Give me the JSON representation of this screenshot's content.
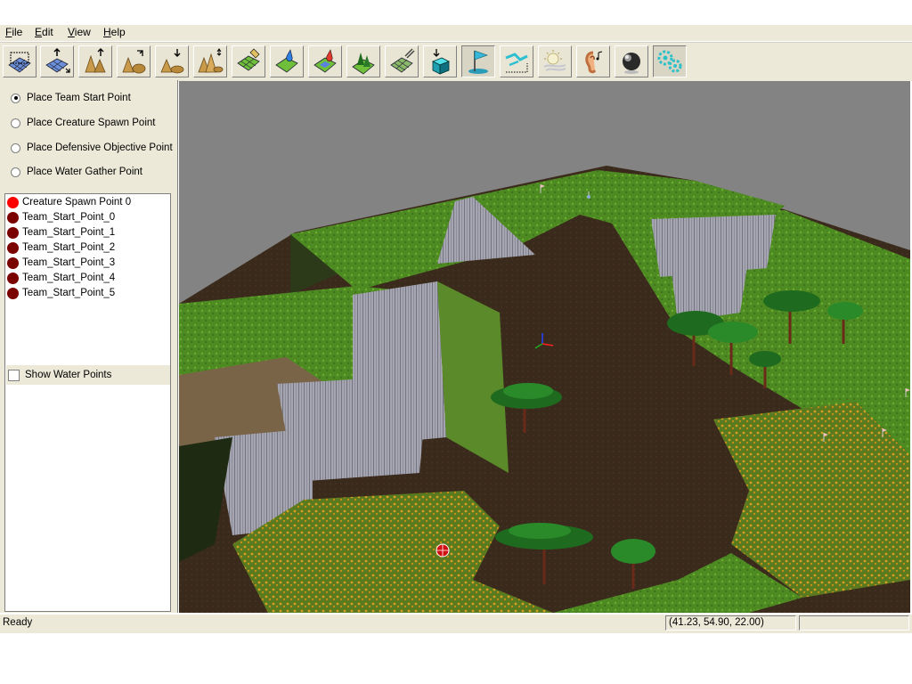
{
  "menu": {
    "items": [
      {
        "label": "File"
      },
      {
        "label": "Edit"
      },
      {
        "label": "View"
      },
      {
        "label": "Help"
      }
    ]
  },
  "toolbar": {
    "buttons": [
      {
        "icon": "select-grid-icon"
      },
      {
        "icon": "move-grid-icon"
      },
      {
        "icon": "raise-terrain-icon"
      },
      {
        "icon": "rotate-terrain-icon"
      },
      {
        "icon": "lower-terrain-icon"
      },
      {
        "icon": "smooth-terrain-icon"
      },
      {
        "icon": "paint-texture-icon"
      },
      {
        "icon": "water-paint-icon"
      },
      {
        "icon": "lava-paint-icon"
      },
      {
        "icon": "place-trees-icon"
      },
      {
        "icon": "erase-objects-icon"
      },
      {
        "icon": "place-object-icon"
      },
      {
        "icon": "place-flag-icon"
      },
      {
        "icon": "path-waypoint-icon"
      },
      {
        "icon": "lighting-fog-icon"
      },
      {
        "icon": "ear-sound-icon"
      },
      {
        "icon": "sphere-material-icon"
      },
      {
        "icon": "settings-gears-icon"
      }
    ],
    "pressed_index": 12
  },
  "placement_options": {
    "options": [
      {
        "label": "Place Team Start Point",
        "checked": true
      },
      {
        "label": "Place Creature Spawn Point",
        "checked": false
      },
      {
        "label": "Place Defensive Objective Point",
        "checked": false
      },
      {
        "label": "Place Water Gather Point",
        "checked": false
      }
    ]
  },
  "point_list": {
    "items": [
      {
        "label": "Creature Spawn Point 0",
        "color": "#ff0000"
      },
      {
        "label": "Team_Start_Point_0",
        "color": "#7a0000"
      },
      {
        "label": "Team_Start_Point_1",
        "color": "#7a0000"
      },
      {
        "label": "Team_Start_Point_2",
        "color": "#7a0000"
      },
      {
        "label": "Team_Start_Point_3",
        "color": "#7a0000"
      },
      {
        "label": "Team_Start_Point_4",
        "color": "#7a0000"
      },
      {
        "label": "Team_Start_Point_5",
        "color": "#7a0000"
      }
    ]
  },
  "show_water": {
    "label": "Show Water Points",
    "checked": false
  },
  "status": {
    "text": "Ready",
    "coords": "(41.23, 54.90, 22.00)"
  },
  "colors": {
    "chrome": "#ece9d8",
    "viewport_bg": "#838383",
    "grass": "#4e8a22",
    "dirt": "#3a2a1c",
    "cliff": "#8a8a95"
  }
}
